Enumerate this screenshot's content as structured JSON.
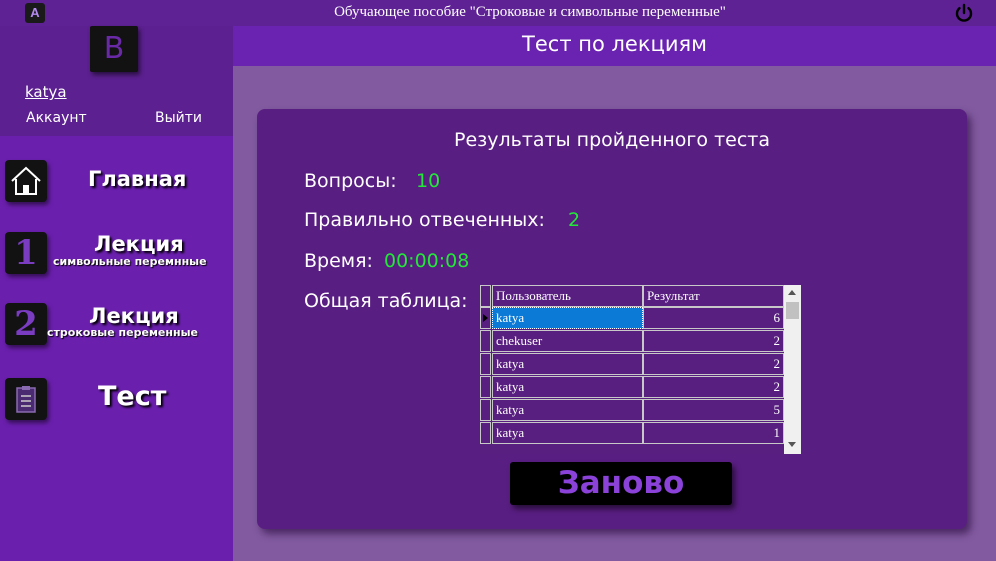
{
  "app": {
    "icon_letter": "A",
    "window_title": "Обучающее пособие \"Строковые и символьные переменные\"",
    "power_icon": "power-icon"
  },
  "sidebar": {
    "avatar_letter": "B",
    "username": "katya",
    "account_label": "Аккаунт",
    "logout_label": "Выйти",
    "nav": [
      {
        "label": "Главная",
        "sub": "",
        "icon": "home-icon"
      },
      {
        "label": "Лекция",
        "sub": "символьные перемнные",
        "icon": "number-one-icon",
        "glyph": "1"
      },
      {
        "label": "Лекция",
        "sub": "строковые переменные",
        "icon": "number-two-icon",
        "glyph": "2"
      },
      {
        "label": "Тест",
        "sub": "",
        "icon": "clipboard-icon"
      }
    ]
  },
  "header": {
    "title": "Тест по лекциям"
  },
  "results": {
    "title": "Результаты пройденного теста",
    "questions_label": "Вопросы:",
    "questions_value": "10",
    "correct_label": "Правильно отвеченных:",
    "correct_value": "2",
    "time_label": "Время:",
    "time_value": "00:00:08",
    "table_label": "Общая таблица:",
    "table": {
      "columns": [
        "Пользователь",
        "Результат"
      ],
      "rows": [
        [
          "katya",
          "6"
        ],
        [
          "chekuser",
          "2"
        ],
        [
          "katya",
          "2"
        ],
        [
          "katya",
          "2"
        ],
        [
          "katya",
          "5"
        ],
        [
          "katya",
          "1"
        ]
      ],
      "selected_row": 0
    },
    "restart_label": "Заново"
  },
  "colors": {
    "accent_green": "#22e838",
    "sidebar": "#6a1fad",
    "card": "#591e82",
    "selection": "#0a7ad6"
  }
}
